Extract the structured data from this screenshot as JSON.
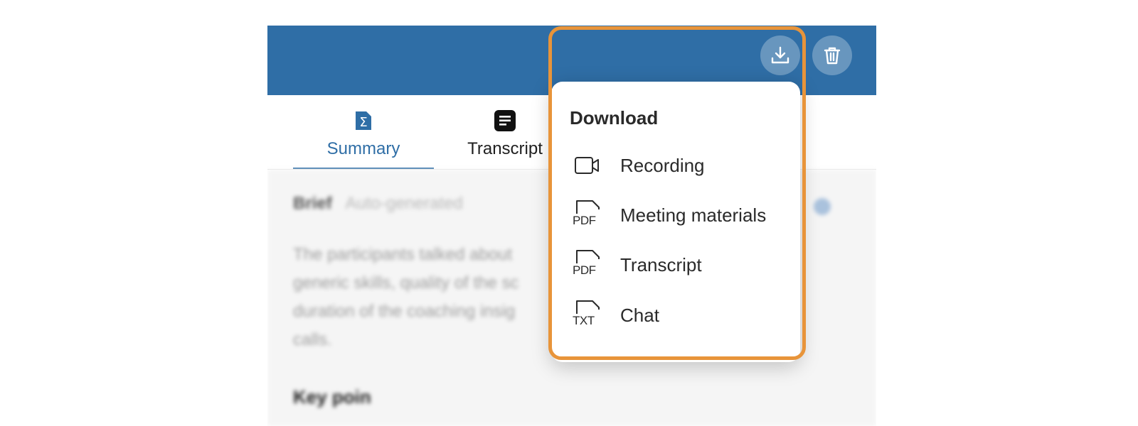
{
  "header": {
    "download_icon": "download-icon",
    "delete_icon": "trash-icon",
    "accent_color": "#2f6ea6"
  },
  "tabs": [
    {
      "label": "Summary",
      "icon": "sigma-icon",
      "active": true
    },
    {
      "label": "Transcript",
      "icon": "document-lines-icon",
      "active": false
    }
  ],
  "brief": {
    "title": "Brief",
    "subtitle": "Auto-generated",
    "lines": [
      "The participants talked about",
      "generic skills, quality of the sc",
      "duration of the coaching insig",
      "calls."
    ]
  },
  "key_section": {
    "title": "Key poin"
  },
  "download_menu": {
    "title": "Download",
    "highlight_color": "#e8943a",
    "items": [
      {
        "label": "Recording",
        "icon": "video-camera-icon"
      },
      {
        "label": "Meeting materials",
        "icon": "pdf-file-icon",
        "ext": "PDF"
      },
      {
        "label": "Transcript",
        "icon": "pdf-file-icon",
        "ext": "PDF"
      },
      {
        "label": "Chat",
        "icon": "txt-file-icon",
        "ext": "TXT"
      }
    ]
  }
}
